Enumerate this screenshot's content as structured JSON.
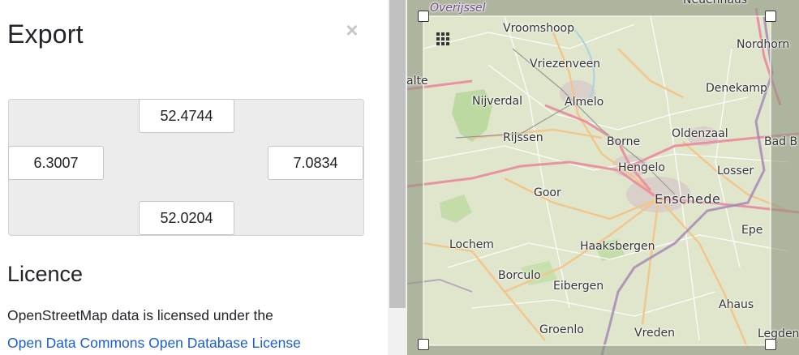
{
  "sidebar": {
    "title": "Export",
    "close_label": "×",
    "bbox": {
      "max_lat": "52.4744",
      "min_lon": "6.3007",
      "max_lon": "7.0834",
      "min_lat": "52.0204"
    },
    "licence_title": "Licence",
    "licence_text": "OpenStreetMap data is licensed under the",
    "licence_link": "Open Data Commons Open Database License"
  },
  "map": {
    "labels": {
      "overijssel": "Overijssel",
      "neuenhaus": "Neuenhaus",
      "vroomshoop": "Vroomshoop",
      "nordhorn": "Nordhorn",
      "vriezenveen": "Vriezenveen",
      "aalte": "alte",
      "denekamp": "Denekamp",
      "nijverdal": "Nijverdal",
      "almelo": "Almelo",
      "rijssen": "Rijssen",
      "borne": "Borne",
      "oldenzaal": "Oldenzaal",
      "badbentheim": "Bad B",
      "hengelo": "Hengelo",
      "losser": "Losser",
      "goor": "Goor",
      "enschede": "Enschede",
      "epe": "Epe",
      "lochem": "Lochem",
      "haaksbergen": "Haaksbergen",
      "borculo": "Borculo",
      "eibergen": "Eibergen",
      "ahaus": "Ahaus",
      "groenlo": "Groenlo",
      "vreden": "Vreden",
      "legden": "Legden"
    },
    "colors": {
      "land": "#dfe6cc",
      "mask": "#9aa08f",
      "forest": "#b6d39a",
      "motorway": "#e892a2",
      "primary": "#f3c58a",
      "border": "#a58ab6",
      "water": "#aad3df"
    }
  }
}
